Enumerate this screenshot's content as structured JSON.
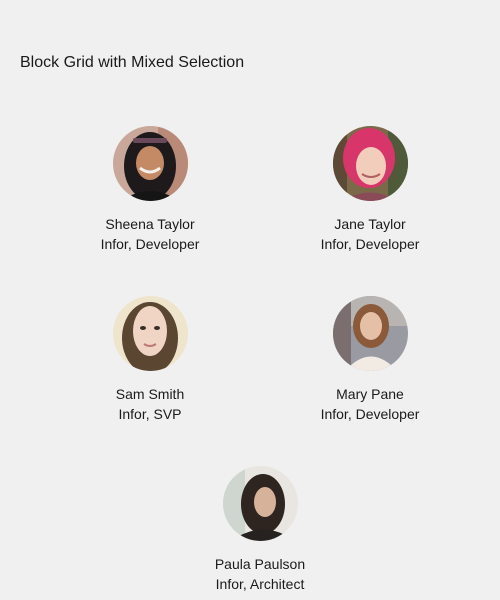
{
  "page": {
    "title": "Block Grid with Mixed Selection"
  },
  "blocks": [
    {
      "name": "Sheena Taylor",
      "role": "Infor, Developer",
      "avatar": "woman-dark-hair-photo"
    },
    {
      "name": "Jane Taylor",
      "role": "Infor, Developer",
      "avatar": "woman-pink-hair-photo"
    },
    {
      "name": "Sam Smith",
      "role": "Infor, SVP",
      "avatar": "woman-long-hair-photo"
    },
    {
      "name": "Mary Pane",
      "role": "Infor, Developer",
      "avatar": "woman-outdoor-photo"
    },
    {
      "name": "Paula Paulson",
      "role": "Infor, Architect",
      "avatar": "woman-reading-photo"
    }
  ]
}
